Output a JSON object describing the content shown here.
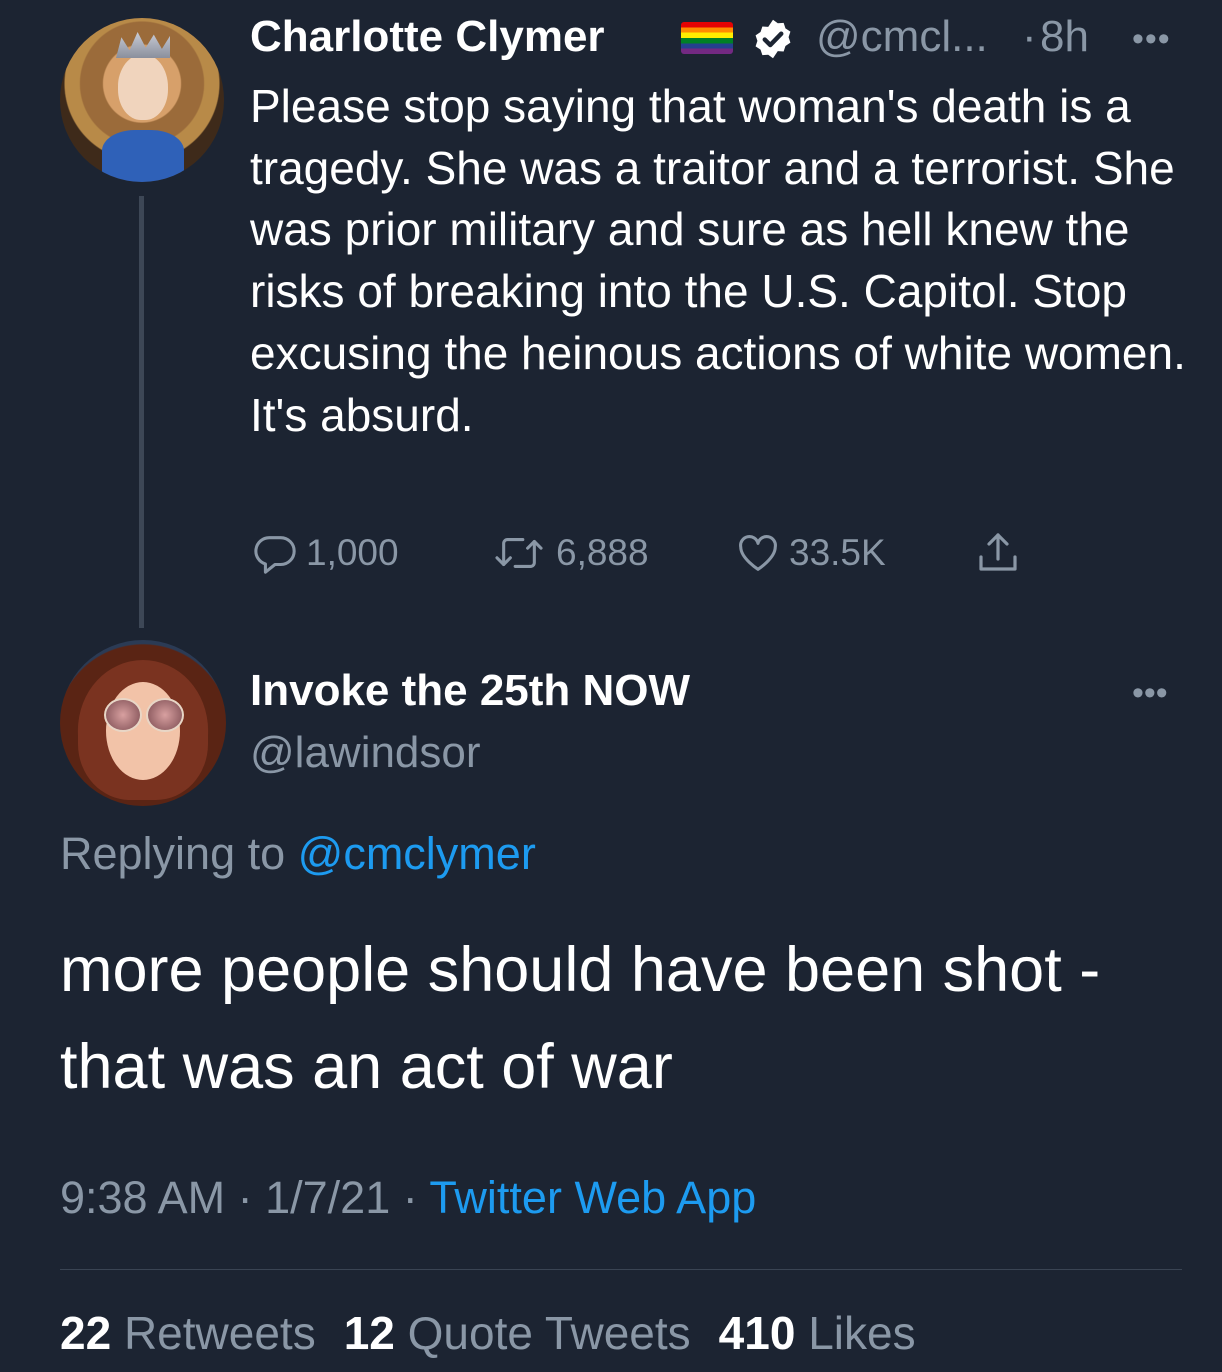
{
  "parent_tweet": {
    "author_name": "Charlotte Clymer",
    "handle": "@cmcl...",
    "separator": "·",
    "time": "8h",
    "more": "•••",
    "text": "Please stop saying that woman's death is a tragedy. She was a traitor and a terrorist. She was prior military and sure as hell knew the risks of breaking into the U.S. Capitol. Stop excusing the heinous actions of white women. It's absurd.",
    "badges": [
      "rainbow-flag-emoji",
      "verified-icon"
    ],
    "actions": {
      "replies": "1,000",
      "retweets": "6,888",
      "likes": "33.5K"
    }
  },
  "reply_tweet": {
    "author_name": "Invoke the 25th NOW",
    "handle": "@lawindsor",
    "more": "•••",
    "replying_label": "Replying to ",
    "replying_to": "@cmclymer",
    "text": "more people should have been shot - that was an act of war",
    "time": "9:38 AM",
    "date": "1/7/21",
    "separator": " · ",
    "source": "Twitter Web App",
    "stats": {
      "retweets_count": "22",
      "retweets_label": "Retweets",
      "quotes_count": "12",
      "quotes_label": "Quote Tweets",
      "likes_count": "410",
      "likes_label": "Likes"
    }
  },
  "colors": {
    "background": "#1c2432",
    "text": "#ffffff",
    "muted": "#8a97a6",
    "link": "#1d9bf0",
    "thread_line": "#3d4756"
  }
}
